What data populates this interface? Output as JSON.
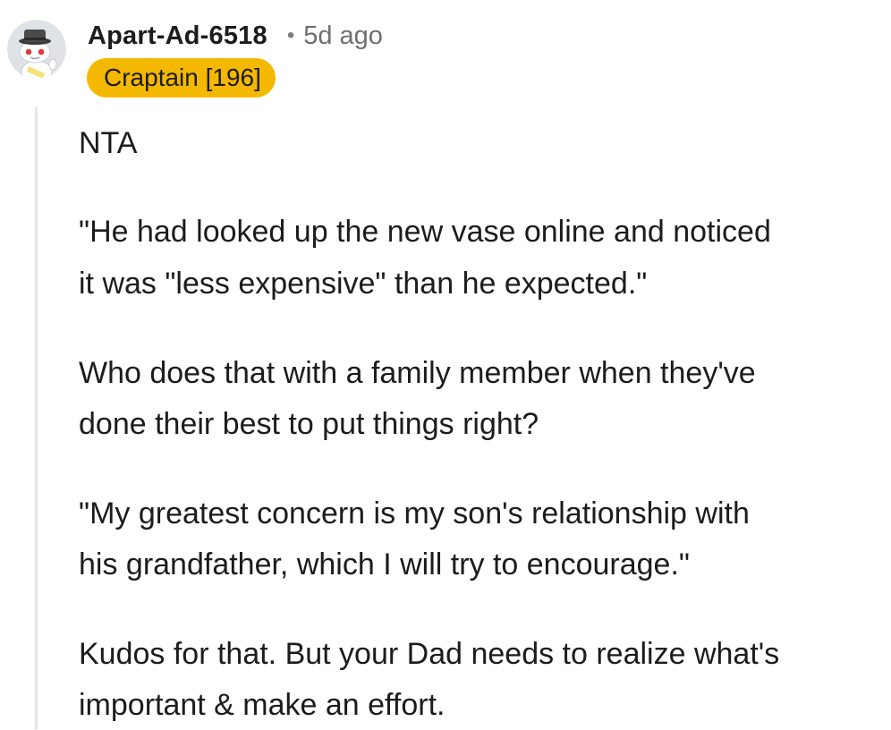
{
  "comment": {
    "author": "Apart-Ad-6518",
    "separator": "•",
    "age": "5d ago",
    "flair": "Craptain [196]",
    "avatar_icon": "snoo-avatar-icon",
    "flair_color": "#f5b800",
    "body": {
      "p1_line1": "NTA",
      "p2_line1": "\"He had looked up the new vase online and noticed",
      "p2_line2": "it was \"less expensive\" than he expected.\"",
      "p3_line1": "Who does that with a family member when they've",
      "p3_line2": "done their best to put things right?",
      "p4_line1": "\"My greatest concern is my son's relationship with",
      "p4_line2": "his grandfather, which I will try to encourage.\"",
      "p5_line1": "Kudos for that. But your Dad needs to realize what's",
      "p5_line2": "important & make an effort."
    }
  }
}
